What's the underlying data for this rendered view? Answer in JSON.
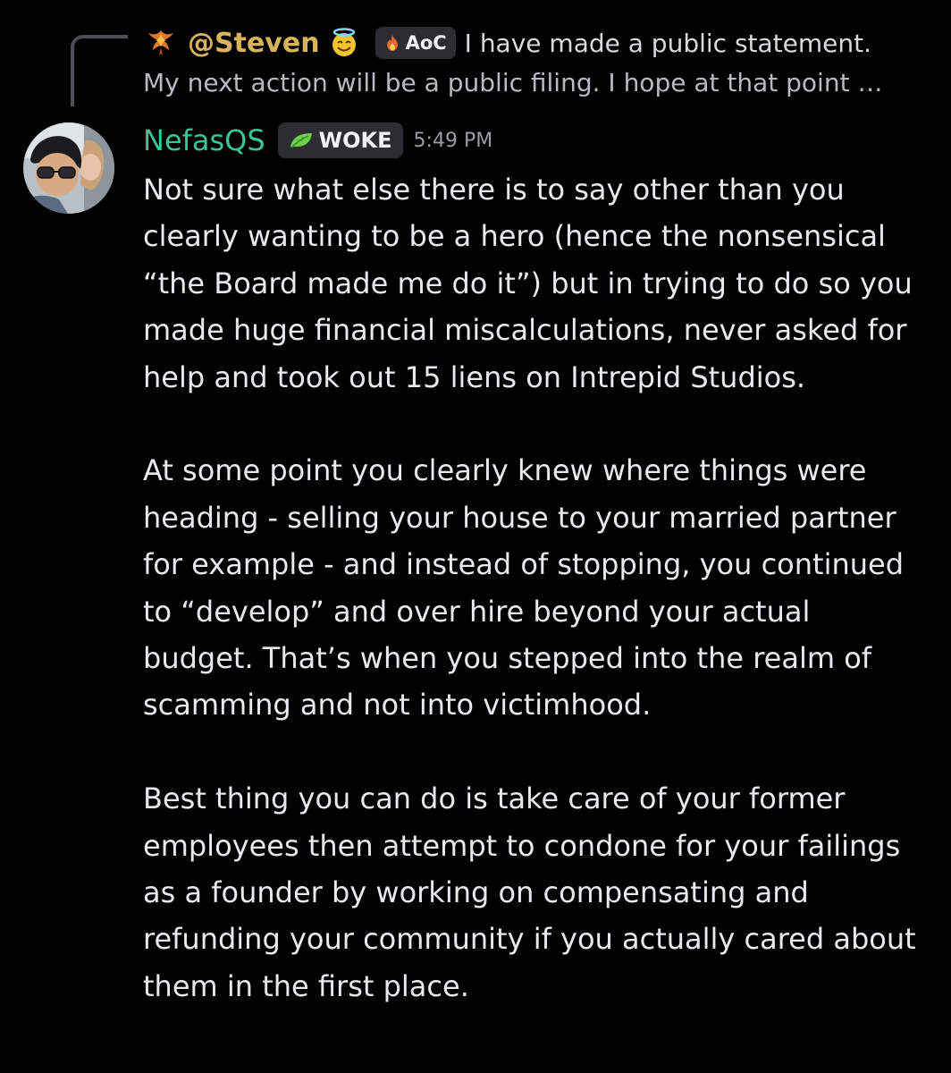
{
  "reply": {
    "username": "@Steven",
    "emoji_icon": "smiling-face-with-halo-icon",
    "badge_icon": "fire-icon",
    "badge_label": "AoC",
    "text_line1": "I have made a public statement.",
    "text_line2": "My next action will be a public filing. I hope at that point …"
  },
  "message": {
    "author": "NefasQS",
    "badge_icon": "leaf-icon",
    "badge_label": "WOKE",
    "timestamp": "5:49 PM",
    "paragraphs": [
      "Not sure what else there is to say other than you clearly wanting to be a hero (hence the nonsensical “the Board made me do it”) but in trying to do so you made huge financial miscalculations, never asked for help and took out 15 liens on Intrepid Studios.",
      "At some point you clearly knew where things were heading - selling your house to your married partner for example - and instead of stopping, you continued to “develop” and over hire beyond your actual budget. That’s when you stepped into the realm of scamming and not into victimhood.",
      "Best thing you can do is take care of your former employees then attempt to condone for your failings as a founder by working on compensating and refunding your community if you actually cared about them in the first place."
    ]
  },
  "colors": {
    "background": "#000000",
    "reply_username": "#d9b35a",
    "author": "#3cc398",
    "badge_bg": "#2c2c31",
    "timestamp": "#9c9ca3"
  }
}
